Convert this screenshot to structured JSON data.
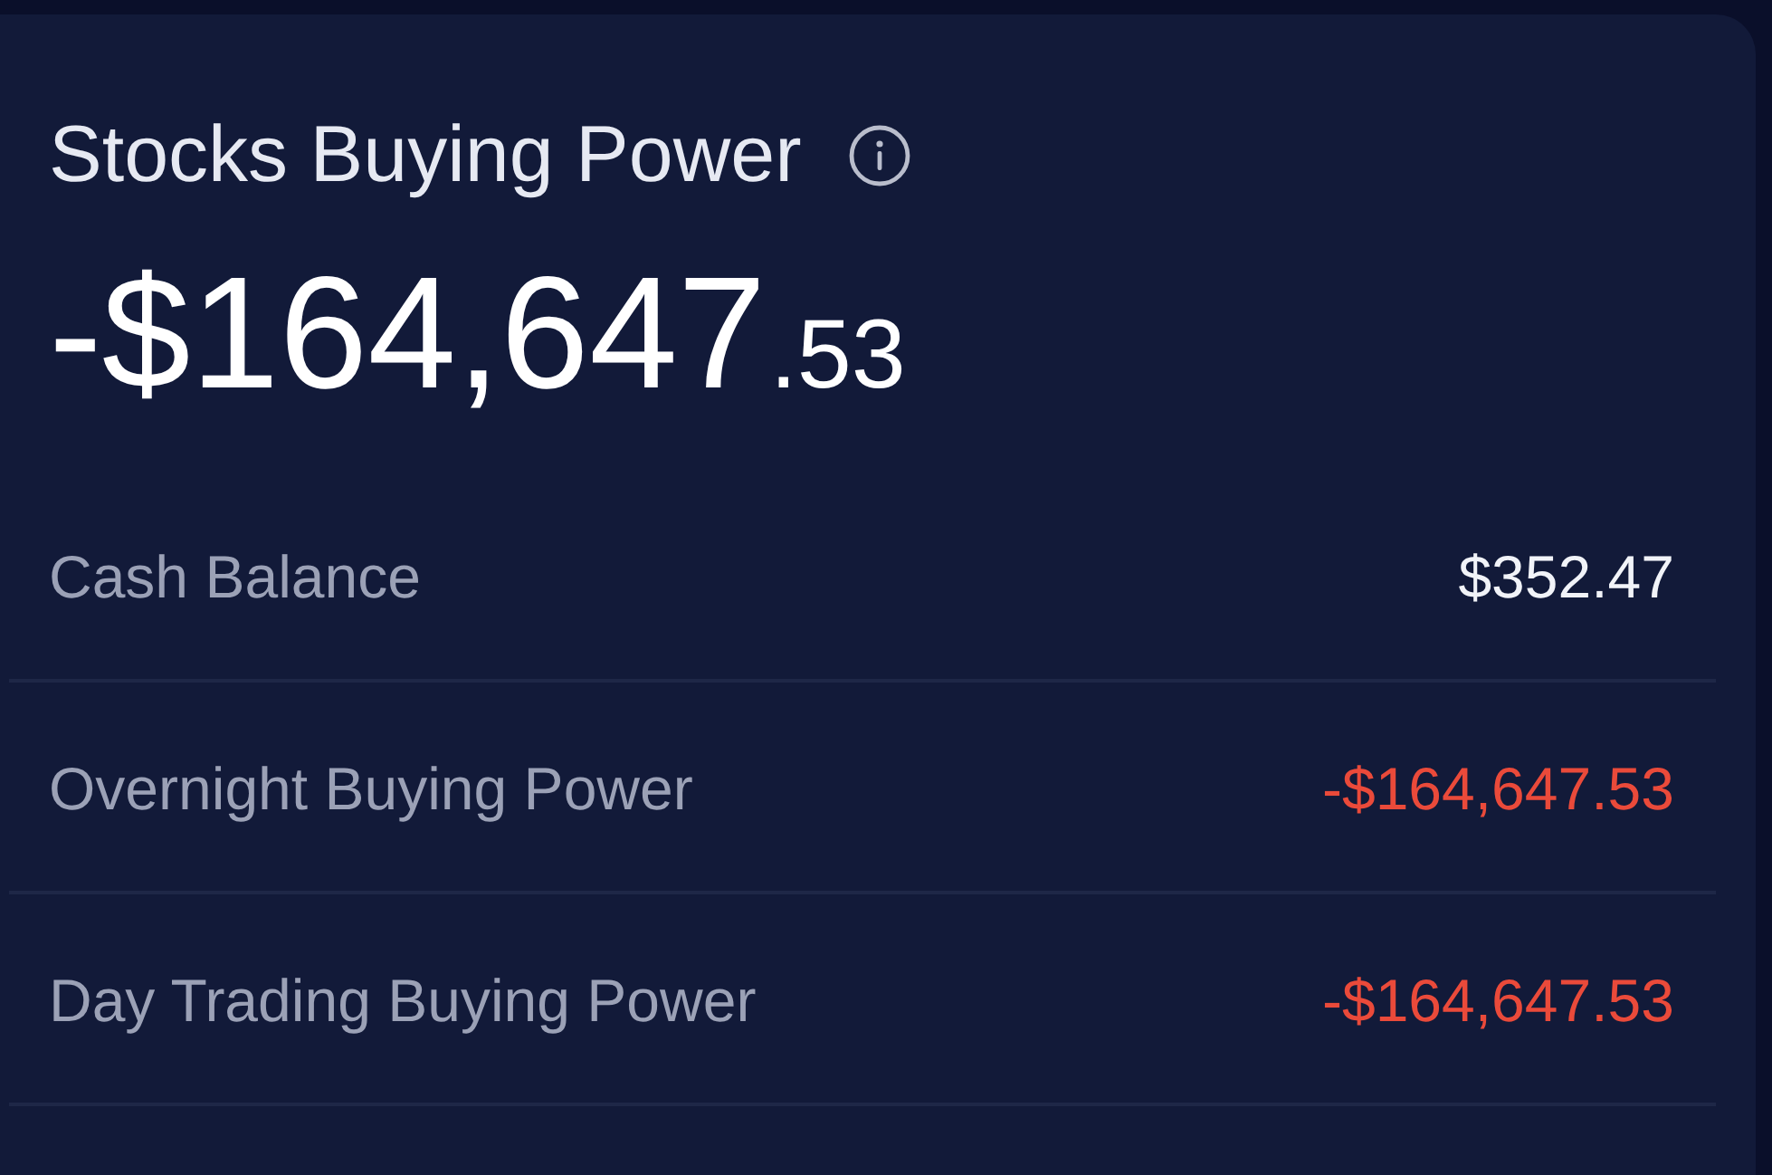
{
  "card": {
    "title": "Stocks Buying Power",
    "total": {
      "whole": "-$164,647",
      "cents": ".53"
    },
    "rows": [
      {
        "label": "Cash Balance",
        "value": "$352.47",
        "negative": false
      },
      {
        "label": "Overnight Buying Power",
        "value": "-$164,647.53",
        "negative": true
      },
      {
        "label": "Day Trading Buying Power",
        "value": "-$164,647.53",
        "negative": true
      }
    ]
  }
}
